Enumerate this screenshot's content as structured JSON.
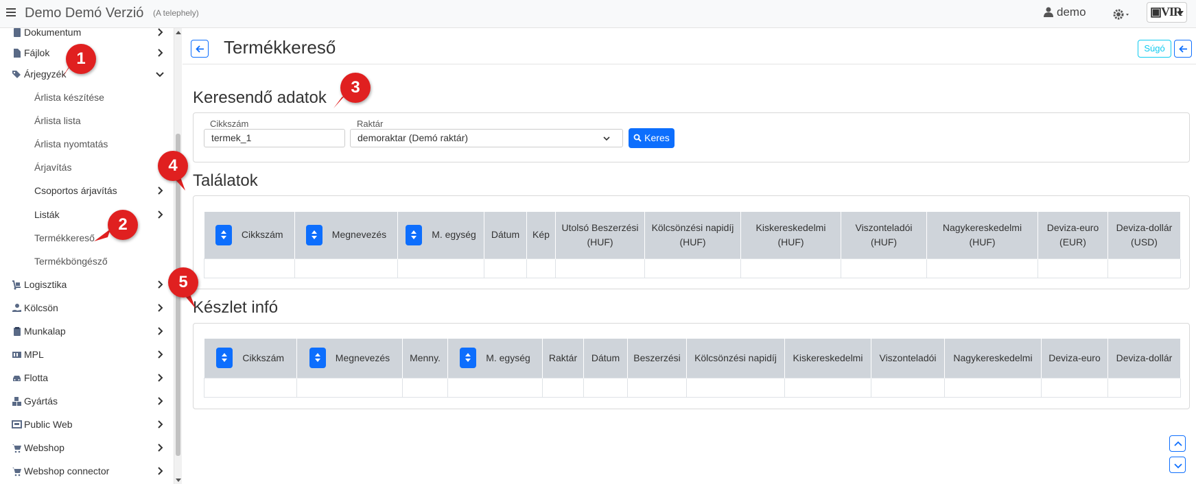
{
  "app": {
    "title": "Demo Demó Verzió",
    "subtitle": "(A telephely)",
    "user": "demo"
  },
  "sidebar": {
    "items": [
      {
        "label": "Dokumentum",
        "icon": "document-icon"
      },
      {
        "label": "Fájlok",
        "icon": "file-icon"
      },
      {
        "label": "Árjegyzék",
        "icon": "tags-icon",
        "expanded": true
      },
      {
        "label": "Logisztika",
        "icon": "dolly-icon"
      },
      {
        "label": "Kölcsön",
        "icon": "hand-icon"
      },
      {
        "label": "Munkalap",
        "icon": "clipboard-icon"
      },
      {
        "label": "MPL",
        "icon": "mpl-icon"
      },
      {
        "label": "Flotta",
        "icon": "car-icon"
      },
      {
        "label": "Gyártás",
        "icon": "cubes-icon"
      },
      {
        "label": "Public Web",
        "icon": "web-icon"
      },
      {
        "label": "Webshop",
        "icon": "cart-icon"
      },
      {
        "label": "Webshop connector",
        "icon": "cart-icon"
      }
    ],
    "subitems": [
      {
        "label": "Árlista készítése"
      },
      {
        "label": "Árlista lista"
      },
      {
        "label": "Árlista nyomtatás"
      },
      {
        "label": "Árjavítás"
      },
      {
        "label": "Csoportos árjavítás",
        "chevron": true
      },
      {
        "label": "Listák",
        "chevron": true
      },
      {
        "label": "Termékkereső",
        "active": true
      },
      {
        "label": "Termékböngésző"
      }
    ]
  },
  "header": {
    "title": "Termékkereső",
    "help_label": "Súgó"
  },
  "search": {
    "title": "Keresendő adatok",
    "cikkszam_label": "Cikkszám",
    "cikkszam_value": "termek_1",
    "raktar_label": "Raktár",
    "raktar_value": "demoraktar (Demó raktár)",
    "button_label": "Keres"
  },
  "results": {
    "title": "Találatok",
    "columns": [
      {
        "label": "Cikkszám",
        "sortable": true
      },
      {
        "label": "Megnevezés",
        "sortable": true
      },
      {
        "label": "M. egység",
        "sortable": true
      },
      {
        "label": "Dátum",
        "sortable": false
      },
      {
        "label": "Kép",
        "sortable": false
      },
      {
        "label": "Utolsó Beszerzési (HUF)",
        "sortable": false
      },
      {
        "label": "Kölcsönzési napidíj (HUF)",
        "sortable": false
      },
      {
        "label": "Kiskereskedelmi (HUF)",
        "sortable": false
      },
      {
        "label": "Viszonteladói (HUF)",
        "sortable": false
      },
      {
        "label": "Nagykereskedelmi (HUF)",
        "sortable": false
      },
      {
        "label": "Deviza-euro (EUR)",
        "sortable": false
      },
      {
        "label": "Deviza-dollár (USD)",
        "sortable": false
      }
    ]
  },
  "stock": {
    "title": "Készlet infó",
    "columns": [
      {
        "label": "Cikkszám",
        "sortable": true
      },
      {
        "label": "Megnevezés",
        "sortable": true
      },
      {
        "label": "Menny.",
        "sortable": false
      },
      {
        "label": "M. egység",
        "sortable": true
      },
      {
        "label": "Raktár",
        "sortable": false
      },
      {
        "label": "Dátum",
        "sortable": false
      },
      {
        "label": "Beszerzési",
        "sortable": false
      },
      {
        "label": "Kölcsönzési napidíj",
        "sortable": false
      },
      {
        "label": "Kiskereskedelmi",
        "sortable": false
      },
      {
        "label": "Viszonteladói",
        "sortable": false
      },
      {
        "label": "Nagykereskedelmi",
        "sortable": false
      },
      {
        "label": "Deviza-euro",
        "sortable": false
      },
      {
        "label": "Deviza-dollár",
        "sortable": false
      }
    ]
  },
  "callouts": [
    "1",
    "2",
    "3",
    "4",
    "5"
  ],
  "colors": {
    "primary": "#0d6efd",
    "info": "#0dcaf0",
    "callout": "#e02020",
    "header_bg": "#cfd4da"
  }
}
